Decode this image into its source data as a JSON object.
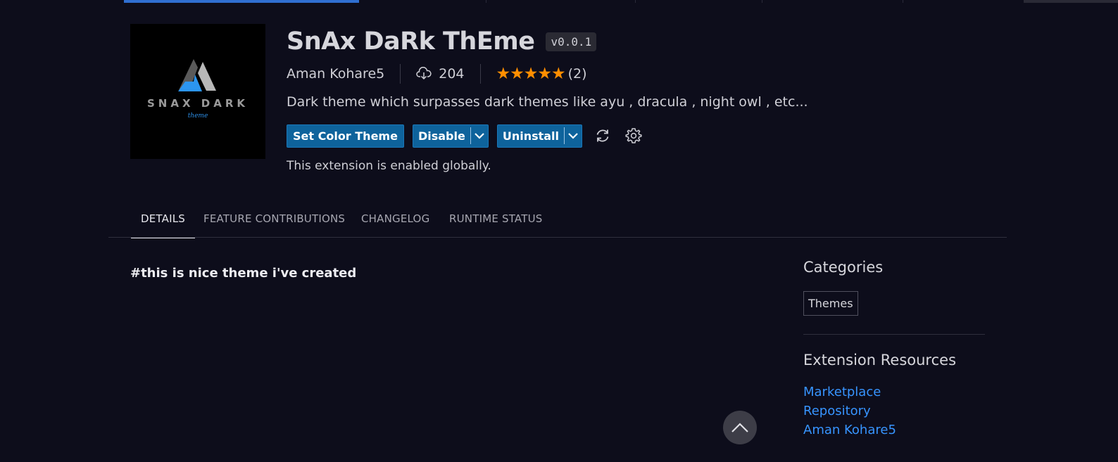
{
  "extension": {
    "title": "SnAx DaRk ThEme",
    "version": "v0.0.1",
    "publisher": "Aman Kohare5",
    "installs": "204",
    "stars": "★★★★★",
    "rating_count": "(2)",
    "description": "Dark theme which surpasses dark themes like ayu , dracula , night owl , etc...",
    "status": "This extension is enabled globally.",
    "icon_text": "SNAX DARK",
    "icon_subtext": "theme"
  },
  "actions": {
    "set_color_theme": "Set Color Theme",
    "disable": "Disable",
    "uninstall": "Uninstall"
  },
  "tabs": [
    {
      "label": "DETAILS",
      "active": true
    },
    {
      "label": "FEATURE CONTRIBUTIONS",
      "active": false
    },
    {
      "label": "CHANGELOG",
      "active": false
    },
    {
      "label": "RUNTIME STATUS",
      "active": false
    }
  ],
  "readme": {
    "text": "#this is nice theme i've created"
  },
  "sidebar": {
    "categories_heading": "Categories",
    "categories": [
      "Themes"
    ],
    "resources_heading": "Extension Resources",
    "resources": [
      "Marketplace",
      "Repository",
      "Aman Kohare5"
    ]
  },
  "icons": {
    "install": "cloud-download-icon",
    "sync": "sync-icon",
    "settings": "gear-icon",
    "scroll_top": "chevron-up-icon",
    "dropdown": "chevron-down-icon"
  },
  "colors": {
    "background": "#0d0d1b",
    "accent_button": "#0e639c",
    "link": "#3794ff",
    "star": "#ff8e00",
    "tab_indicator": "#3794ff"
  }
}
